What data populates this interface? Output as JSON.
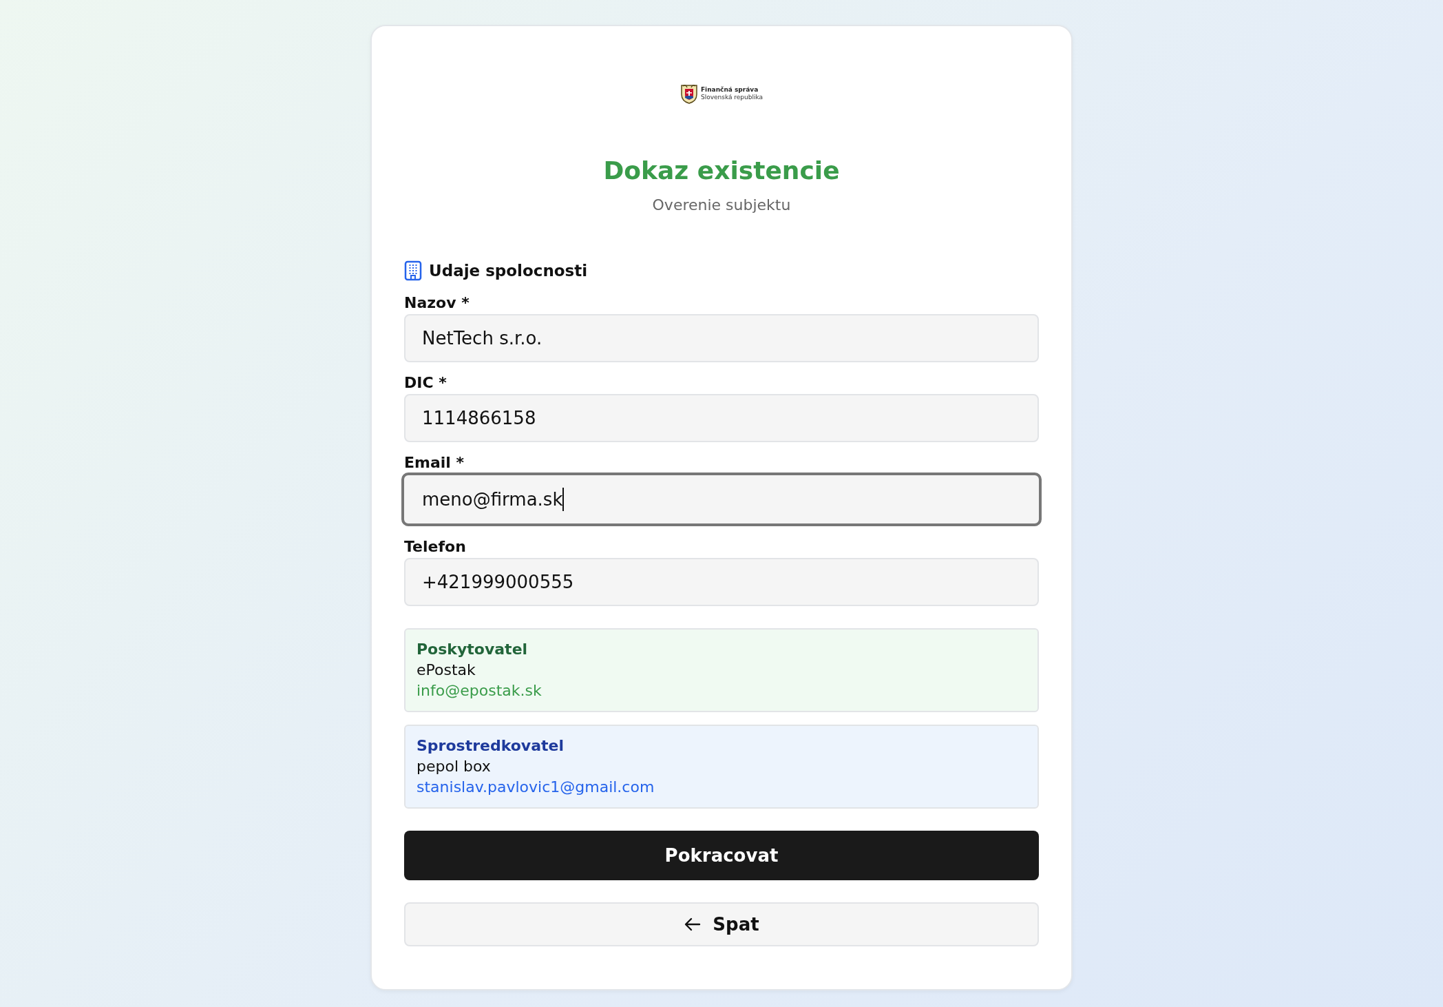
{
  "logo": {
    "line_1": "Finančná správa",
    "line_2": "Slovenská republika"
  },
  "title": "Dokaz existencie",
  "subtitle": "Overenie subjektu",
  "section": {
    "heading": "Udaje spolocnosti"
  },
  "fields": [
    {
      "label": "Nazov *",
      "value": "NetTech s.r.o.",
      "focused": false
    },
    {
      "label": "DIC *",
      "value": "1114866158",
      "focused": false
    },
    {
      "label": "Email *",
      "value": "meno@firma.sk",
      "focused": true
    },
    {
      "label": "Telefon",
      "value": "+421999000555",
      "focused": false
    }
  ],
  "info_boxes": [
    {
      "kind": "provider",
      "heading": "Poskytovatel",
      "name": "ePostak",
      "email": "info@epostak.sk"
    },
    {
      "kind": "intermediary",
      "heading": "Sprostredkovatel",
      "name": "pepol box",
      "email": "stanislav.pavlovic1@gmail.com"
    }
  ],
  "buttons": {
    "continue": "Pokracovat",
    "back": "Spat"
  }
}
